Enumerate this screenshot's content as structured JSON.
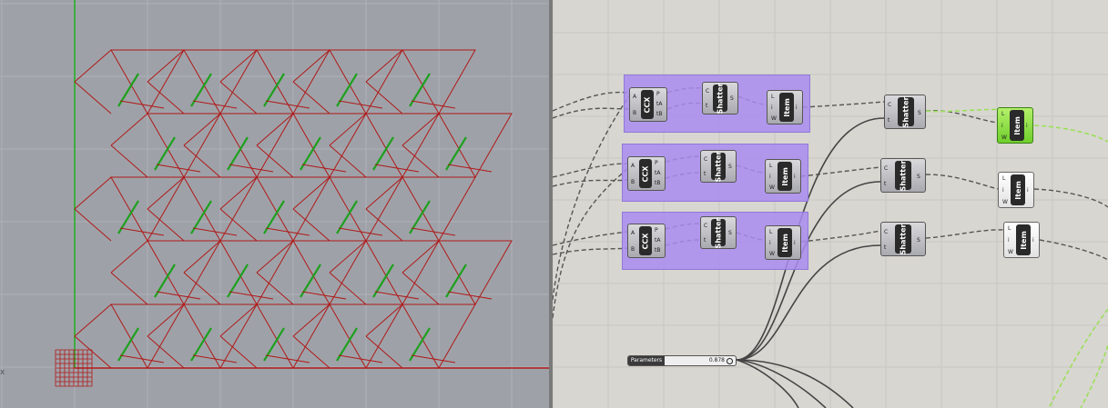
{
  "viewport": {
    "axis_label": "x"
  },
  "canvas": {
    "ccx_label": "CCX",
    "shatter_label": "Shatter",
    "item_label": "Item",
    "ccx_ports_in": [
      "A",
      "B"
    ],
    "ccx_ports_out": [
      "P",
      "tA",
      "tB"
    ],
    "shatter_ports_in": [
      "C",
      "t"
    ],
    "shatter_ports_out": [
      "S"
    ],
    "item_ports_in": [
      "L",
      "i",
      "W"
    ],
    "item_ports_out": [
      "i"
    ],
    "slider": {
      "label": "Parameters",
      "value": "0.878"
    }
  },
  "colors": {
    "viewport_bg": "#9ea2a8",
    "canvas_bg": "#d8d6d0",
    "group": "#a98cf0",
    "geometry_red": "#b01818",
    "geometry_green": "#1fa01f",
    "active_item": "#7dd835"
  }
}
